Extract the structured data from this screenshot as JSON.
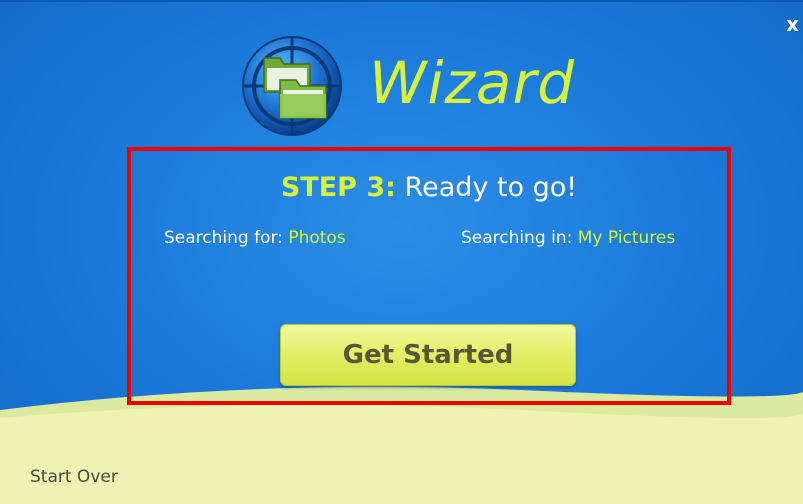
{
  "window": {
    "close_label": "x"
  },
  "header": {
    "title": "Wizard",
    "logo_icon": "folders-globe-icon"
  },
  "step": {
    "label": "STEP 3:",
    "text": "Ready to go!"
  },
  "search": {
    "for_label": "Searching for:",
    "for_value": "Photos",
    "in_label": "Searching in:",
    "in_value": "My Pictures"
  },
  "actions": {
    "get_started_label": "Get Started",
    "start_over_label": "Start Over"
  },
  "colors": {
    "background_blue": "#1a78d8",
    "accent_lime": "#d6f23a",
    "footer_cream": "#eef3b4",
    "highlight_red": "#ee0000"
  }
}
